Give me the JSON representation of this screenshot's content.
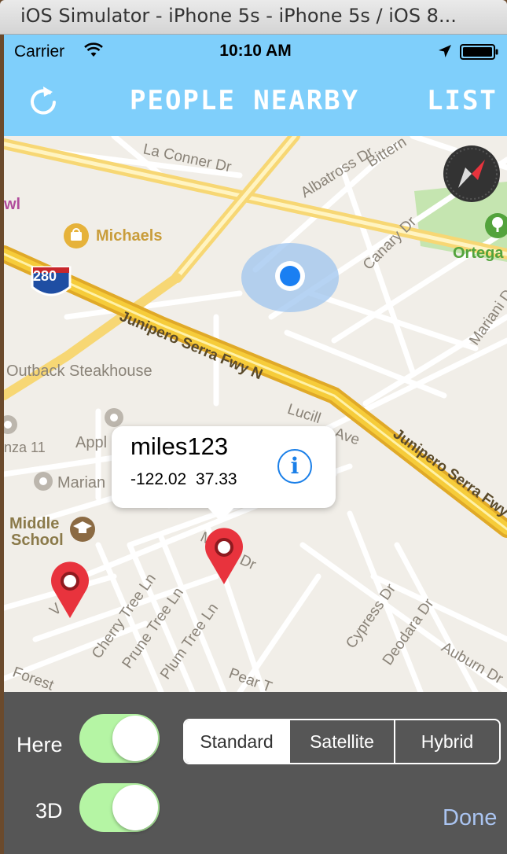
{
  "window": {
    "title": "iOS Simulator - iPhone 5s - iPhone 5s / iOS 8..."
  },
  "status_bar": {
    "carrier": "Carrier",
    "time": "10:10 AM"
  },
  "nav_bar": {
    "title": "PEOPLE NEARBY",
    "list_label": "LIST",
    "refresh_icon": "refresh-icon"
  },
  "map": {
    "streets": {
      "la_conner": "La Conner Dr",
      "albatross": "Albatross Dr",
      "bittern": "Bittern",
      "canary": "Canary Dr",
      "mariani": "Mariani D",
      "junipero_top": "Junipero Serra Fwy N",
      "junipero_bottom": "Junipero Serra Fwy",
      "lucille": "Lucill",
      "ave": "Ave",
      "cherry_tree": "Cherry Tree Ln",
      "prune_tree": "Prune Tree Ln",
      "plum_tree": "Plum Tree Ln",
      "cypress": "Cypress Dr",
      "deodara": "Deodara Dr",
      "auburn": "Auburn Dr",
      "pear": "Pear T",
      "forest": "Forest",
      "m_dr": "Dr",
      "m_prefix": "M",
      "v_prefix": "V"
    },
    "places": {
      "michaels": "Michaels",
      "outback": "Outback Steakhouse",
      "apple": "Appl",
      "manza": "nza 11",
      "mariani": "Marian",
      "middle_school_1": "Middle",
      "middle_school_2": "School",
      "ortega": "Ortega",
      "wl": "wl"
    },
    "highway_shield": "280",
    "callout": {
      "title": "miles123",
      "coords": "-122.02  37.33",
      "info_glyph": "i"
    }
  },
  "toolbar": {
    "here_label": "Here",
    "three_d_label": "3D",
    "here_on": true,
    "three_d_on": true,
    "map_types": [
      "Standard",
      "Satellite",
      "Hybrid"
    ],
    "selected_map_type": "Standard",
    "done_label": "Done"
  },
  "colors": {
    "nav_bg": "#7fcffb",
    "toolbar_bg": "#565656",
    "switch_on": "#b5f5a4",
    "pin_red": "#e8333d",
    "done_link": "#aac4f1",
    "info_blue": "#1a7fe8"
  }
}
